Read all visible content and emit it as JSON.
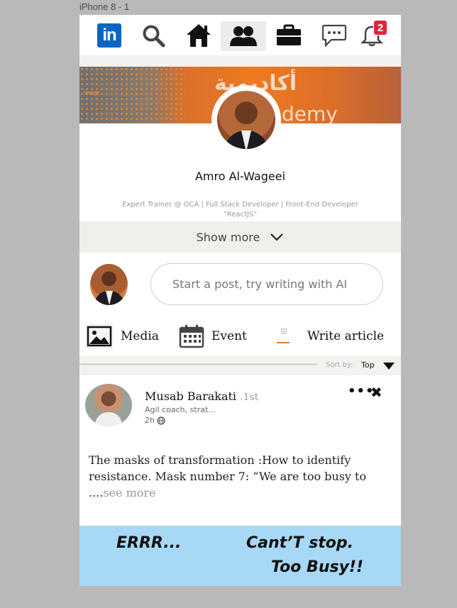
{
  "artboard": {
    "title": "iPhone 8 - 1"
  },
  "nav": {
    "logo_text": "in",
    "notifications_count": "2",
    "icons": [
      "linkedin-logo",
      "search-icon",
      "home-icon",
      "network-icon",
      "jobs-briefcase-icon",
      "messaging-icon",
      "notifications-bell-icon"
    ],
    "active_item": "network-icon",
    "badge_color": "#e0243a",
    "brand_color": "#0a66c2"
  },
  "profile": {
    "name": "Amro Al-Wageei",
    "headline": "Expert Trainer @ OCA | Full Stack Developer | Front-End Developer \"ReactJS\"",
    "show_more_label": "Show more",
    "banner": {
      "arabic_text": "أكاديمية",
      "latin_text": "demy",
      "left_label": "orange"
    }
  },
  "composer": {
    "placeholder": "Start a post, try writing with AI",
    "actions": [
      {
        "label": "Media",
        "icon": "image-icon"
      },
      {
        "label": "Event",
        "icon": "calendar-icon"
      },
      {
        "label": "Write article",
        "icon": "article-icon"
      }
    ]
  },
  "feed": {
    "sort_label": "Sort by:",
    "sort_value": "Top"
  },
  "post": {
    "author": "Musab Barakati",
    "degree": ".1st",
    "headline": "Agil coach, strat...",
    "time": "2h",
    "text": "The masks of transformation :How to identify resistance. Mask number 7: “We are too busy to ....",
    "see_more": "see more",
    "image": {
      "text1": "ERRR...",
      "text2": "Cant’T stop.",
      "text3": "Too Busy!!",
      "bg_color": "#a7d8f5"
    }
  }
}
